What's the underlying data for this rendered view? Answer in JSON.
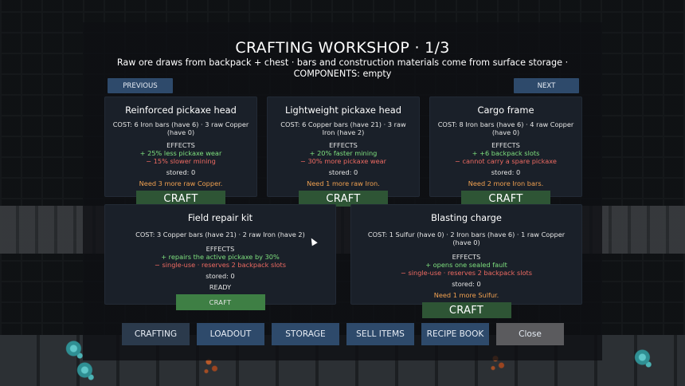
{
  "header": {
    "title": "CRAFTING WORKSHOP  ·  1/3",
    "subtitle": "Raw ore draws from backpack + chest · bars and construction materials come from surface storage  ·  COMPONENTS: empty"
  },
  "nav": {
    "previous_label": "PREVIOUS",
    "next_label": "NEXT"
  },
  "recipes": [
    {
      "name": "Reinforced pickaxe head",
      "cost": "COST:  6 Iron bars (have 6)  ·  3 raw Copper (have 0)",
      "effects_label": "EFFECTS",
      "positive": "+ 25% less pickaxe wear",
      "negative": "− 15% slower mining",
      "stored": "stored: 0",
      "status": "Need 3 more raw Copper.",
      "craft_label": "CRAFT"
    },
    {
      "name": "Lightweight pickaxe head",
      "cost": "COST:  6 Copper bars (have 21)  ·  3 raw Iron (have 2)",
      "effects_label": "EFFECTS",
      "positive": "+ 20% faster mining",
      "negative": "− 30% more pickaxe wear",
      "stored": "stored: 0",
      "status": "Need 1 more raw Iron.",
      "craft_label": "CRAFT"
    },
    {
      "name": "Cargo frame",
      "cost": "COST:  8 Iron bars (have 6)  ·  4 raw Copper (have 0)",
      "effects_label": "EFFECTS",
      "positive": "+ +6 backpack slots",
      "negative": "− cannot carry a spare pickaxe",
      "stored": "stored: 0",
      "status": "Need 2 more Iron bars.",
      "craft_label": "CRAFT"
    },
    {
      "name": "Field repair kit",
      "cost": "COST:  3 Copper bars (have 21)  ·  2 raw Iron (have 2)",
      "effects_label": "EFFECTS",
      "positive": "+ repairs the active pickaxe by 30%",
      "negative": "− single-use · reserves 2 backpack slots",
      "stored": "stored: 0",
      "status": "READY",
      "craft_label": "CRAFT"
    },
    {
      "name": "Blasting charge",
      "cost": "COST:  1 Sulfur (have 0)  ·  2 Iron bars (have 6)  ·  1 raw Copper (have 0)",
      "effects_label": "EFFECTS",
      "positive": "+ opens one sealed fault",
      "negative": "− single-use · reserves 2 backpack slots",
      "stored": "stored: 0",
      "status": "Need 1 more Sulfur.",
      "craft_label": "CRAFT"
    }
  ],
  "tabs": {
    "crafting": "CRAFTING",
    "loadout": "LOADOUT",
    "storage": "STORAGE",
    "sell": "SELL ITEMS",
    "recipes": "RECIPE BOOK",
    "close": "Close"
  },
  "colors": {
    "panel": "#1a2029",
    "button_blue": "#2e4a6b",
    "craft_green": "#2e5535",
    "craft_ready": "#3e7f44",
    "positive": "#7ee07e",
    "negative": "#ee6a62",
    "need": "#f0a050"
  }
}
